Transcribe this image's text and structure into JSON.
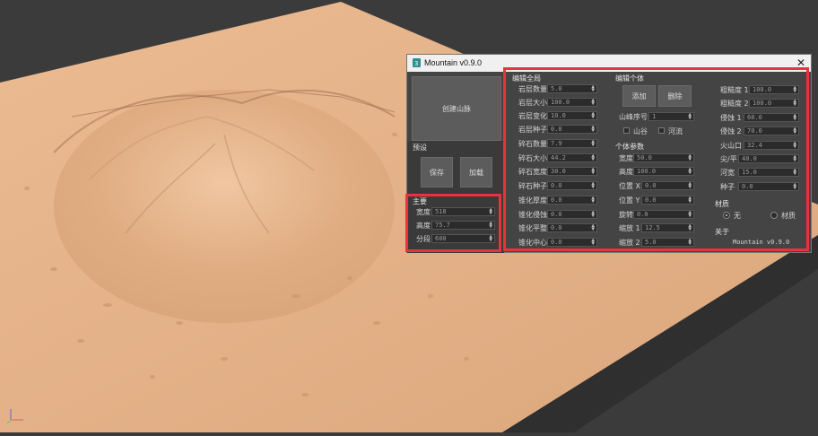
{
  "window": {
    "title": "Mountain v0.9.0"
  },
  "left": {
    "create_button": "创建山脉",
    "presets_label": "预设",
    "save_button": "保存",
    "load_button": "加载",
    "main_label": "主要",
    "main_fields": [
      {
        "label": "宽度",
        "value": "518"
      },
      {
        "label": "高度",
        "value": "75.7"
      },
      {
        "label": "分段",
        "value": "600"
      }
    ]
  },
  "global": {
    "header": "编辑全局",
    "fields": [
      {
        "label": "岩层数量",
        "value": "5.0"
      },
      {
        "label": "岩层大小",
        "value": "100.0"
      },
      {
        "label": "岩层变化",
        "value": "10.0"
      },
      {
        "label": "岩层种子",
        "value": "0.0"
      },
      {
        "label": "碎石数量",
        "value": "7.9"
      },
      {
        "label": "碎石大小",
        "value": "44.2"
      },
      {
        "label": "碎石宽度",
        "value": "30.0"
      },
      {
        "label": "碎石种子",
        "value": "0.0"
      },
      {
        "label": "锥化厚度",
        "value": "0.0"
      },
      {
        "label": "锥化侵蚀",
        "value": "0.0"
      },
      {
        "label": "锥化平整",
        "value": "0.0"
      },
      {
        "label": "锥化中心",
        "value": "0.0"
      }
    ]
  },
  "individual": {
    "header": "编辑个体",
    "add_button": "添加",
    "delete_button": "删除",
    "mountain_index_label": "山峰序号",
    "mountain_index_value": "1",
    "valley_label": "山谷",
    "river_label": "河流",
    "params_header": "个体参数",
    "fields": [
      {
        "label": "宽度",
        "value": "50.0"
      },
      {
        "label": "高度",
        "value": "100.0"
      },
      {
        "label": "位置 X",
        "value": "0.0"
      },
      {
        "label": "位置 Y",
        "value": "0.0"
      },
      {
        "label": "旋转",
        "value": "0.0"
      },
      {
        "label": "缩放 1",
        "value": "12.5"
      },
      {
        "label": "缩放 2",
        "value": "5.0"
      }
    ]
  },
  "right": {
    "fields": [
      {
        "label": "粗糙度 1",
        "value": "100.0"
      },
      {
        "label": "粗糙度 2",
        "value": "100.0"
      },
      {
        "label": "侵蚀 1",
        "value": "60.0"
      },
      {
        "label": "侵蚀 2",
        "value": "70.0"
      },
      {
        "label": "火山口",
        "value": "32.4"
      },
      {
        "label": "尖/平",
        "value": "40.0"
      },
      {
        "label": "河宽",
        "value": "15.0"
      },
      {
        "label": "种子",
        "value": "0.0"
      }
    ],
    "material_header": "材质",
    "material_none": "无",
    "material_mat": "材质",
    "about_header": "关于",
    "version_text": "Mountain v0.9.0"
  },
  "colors": {
    "terrain": "#e3b38a",
    "terrain_shadow": "#b8865f",
    "background": "#3b3b3b",
    "highlight": "#e8333a",
    "panel": "#444444"
  }
}
